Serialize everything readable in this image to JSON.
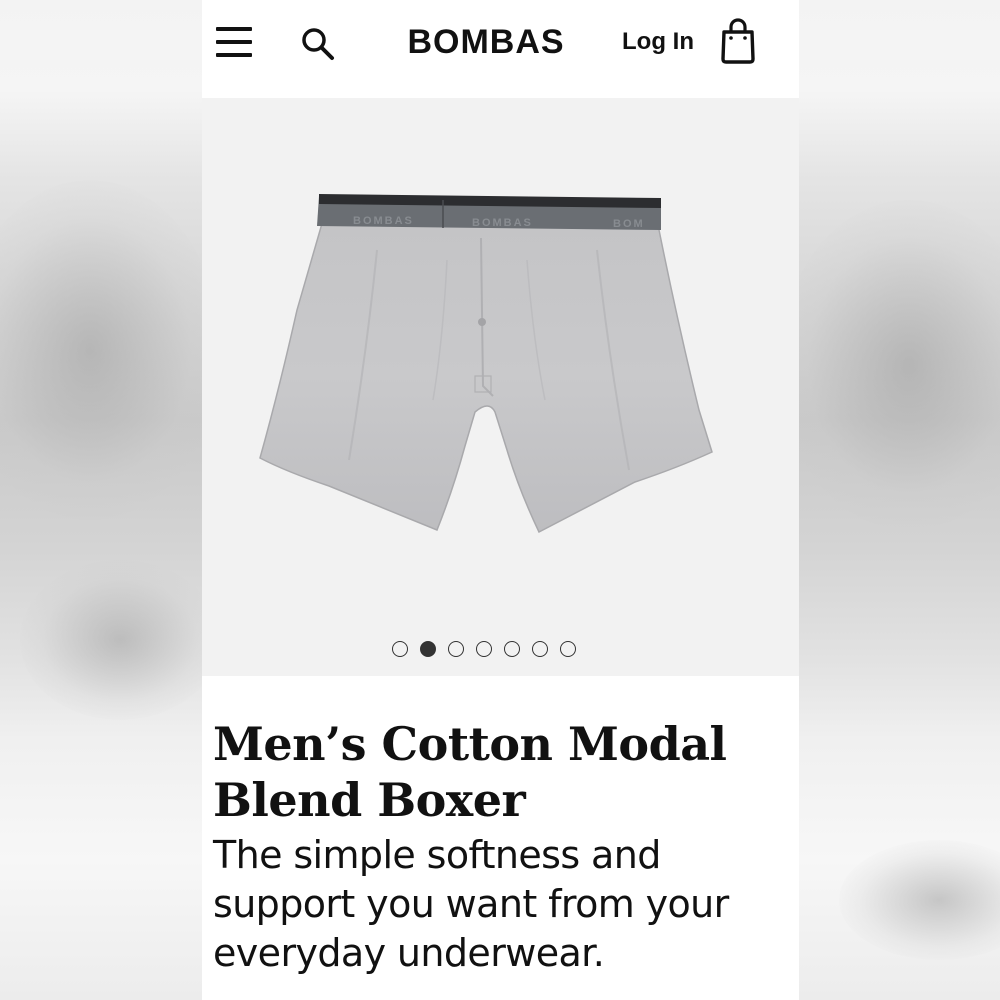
{
  "header": {
    "menu_icon": "hamburger-menu-icon",
    "search_icon": "search-icon",
    "logo": "BOMBAS",
    "login_label": "Log In",
    "bag_icon": "shopping-bag-icon"
  },
  "gallery": {
    "image": "gray-boxer-shorts-product-photo",
    "slide_count": 7,
    "active_slide": 2
  },
  "product": {
    "title": "Men’s Cotton Modal Blend Boxer",
    "description": "The simple softness and support you want from your everyday underwear."
  },
  "colors": {
    "background": "#ffffff",
    "gallery_bg": "#f2f2f2",
    "text": "#111111"
  }
}
